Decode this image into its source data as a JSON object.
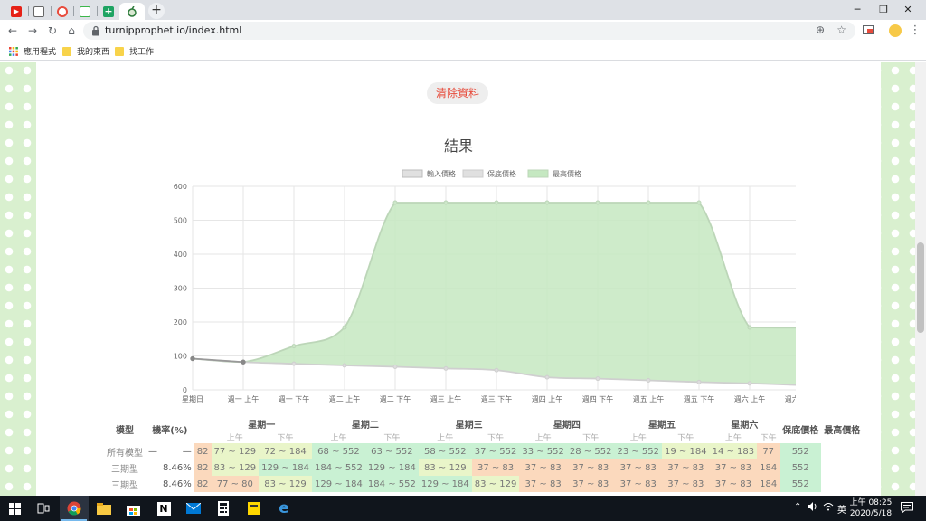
{
  "browser": {
    "url": "turnipprophet.io/index.html",
    "window_controls": {
      "minimize": "─",
      "maximize": "❐",
      "close": "✕"
    },
    "new_tab": "+",
    "bookmarks": [
      {
        "label": "應用程式"
      },
      {
        "label": "我的東西"
      },
      {
        "label": "找工作"
      }
    ]
  },
  "page": {
    "clear_button": "清除資料",
    "result_title": "結果"
  },
  "chart_data": {
    "type": "area",
    "legend": [
      "輸入價格",
      "保底價格",
      "最高價格"
    ],
    "legend_position": "top",
    "categories": [
      "星期日",
      "週一 上午",
      "週一 下午",
      "週二 上午",
      "週二 下午",
      "週三 上午",
      "週三 下午",
      "週四 上午",
      "週四 下午",
      "週五 上午",
      "週五 下午",
      "週六 上午",
      "週六 下午"
    ],
    "ylim": [
      0,
      600
    ],
    "yticks": [
      0,
      100,
      200,
      300,
      400,
      500,
      600
    ],
    "series": [
      {
        "name": "輸入價格",
        "values": [
          92,
          82,
          null,
          null,
          null,
          null,
          null,
          null,
          null,
          null,
          null,
          null,
          null
        ],
        "color": "#999999"
      },
      {
        "name": "保底價格",
        "values": [
          92,
          82,
          77,
          72,
          68,
          63,
          58,
          37,
          33,
          28,
          23,
          19,
          14
        ],
        "color": "#cccccc"
      },
      {
        "name": "最高價格",
        "values": [
          92,
          82,
          129,
          184,
          552,
          552,
          552,
          552,
          552,
          552,
          552,
          184,
          183
        ],
        "color": "#c5e8c1"
      }
    ]
  },
  "table": {
    "headers": {
      "model": "模型",
      "prob": "機率(%)",
      "days": [
        "星期一",
        "星期二",
        "星期三",
        "星期四",
        "星期五",
        "星期六"
      ],
      "am": "上午",
      "pm": "下午",
      "min": "保底價格",
      "max": "最高價格"
    },
    "rows": [
      {
        "model": "所有模型",
        "prob_a": "—",
        "prob_b": "—",
        "buy": "82",
        "cells": [
          "77 ~ 129",
          "72 ~ 184",
          "68 ~ 552",
          "63 ~ 552",
          "58 ~ 552",
          "37 ~ 552",
          "33 ~ 552",
          "28 ~ 552",
          "23 ~ 552",
          "19 ~ 184",
          "14 ~ 183"
        ],
        "min": "77",
        "max": "552"
      },
      {
        "model": "三期型",
        "prob_a": "",
        "prob_b": "8.46%",
        "buy": "82",
        "cells": [
          "83 ~ 129",
          "129 ~ 184",
          "184 ~ 552",
          "129 ~ 184",
          "83 ~ 129",
          "37 ~ 83",
          "37 ~ 83",
          "37 ~ 83",
          "37 ~ 83",
          "37 ~ 83",
          "37 ~ 83"
        ],
        "min": "184",
        "max": "552"
      },
      {
        "model": "三期型",
        "prob_a": "",
        "prob_b": "8.46%",
        "buy": "82",
        "cells": [
          "77 ~ 80",
          "83 ~ 129",
          "129 ~ 184",
          "184 ~ 552",
          "129 ~ 184",
          "83 ~ 129",
          "37 ~ 83",
          "37 ~ 83",
          "37 ~ 83",
          "37 ~ 83",
          "37 ~ 83"
        ],
        "min": "184",
        "max": "552"
      }
    ]
  },
  "taskbar": {
    "time": "上午 08:25",
    "date": "2020/5/18",
    "ime": "英",
    "tray_up": "⌃"
  }
}
